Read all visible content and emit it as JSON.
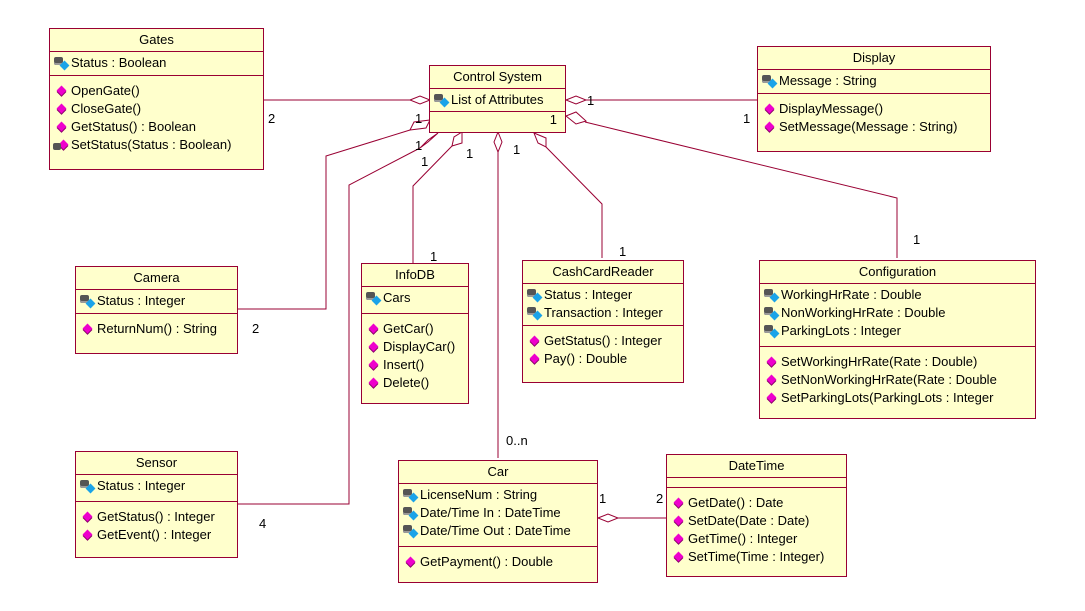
{
  "diagram": {
    "type": "UML class diagram",
    "colors": {
      "border": "#990033",
      "fill": "#ffffcc",
      "line": "#990033",
      "operation_icon": "#ee00cc",
      "attribute_icon": "#1aa3e8"
    },
    "classes": {
      "gates": {
        "name": "Gates",
        "attributes": [
          {
            "text": "Status : Boolean",
            "icon": "private-attribute-icon"
          }
        ],
        "operations": [
          {
            "text": "OpenGate()",
            "icon": "public-operation-icon"
          },
          {
            "text": "CloseGate()",
            "icon": "public-operation-icon"
          },
          {
            "text": "GetStatus() : Boolean",
            "icon": "public-operation-icon"
          },
          {
            "text": "SetStatus(Status : Boolean)",
            "icon": "private-operation-icon"
          }
        ]
      },
      "control_system": {
        "name": "Control System",
        "attributes": [
          {
            "text": "List of Attributes",
            "icon": "private-attribute-icon"
          }
        ],
        "operations_note": "1"
      },
      "display": {
        "name": "Display",
        "attributes": [
          {
            "text": "Message : String",
            "icon": "private-attribute-icon"
          }
        ],
        "operations": [
          {
            "text": "DisplayMessage()",
            "icon": "public-operation-icon"
          },
          {
            "text": "SetMessage(Message : String)",
            "icon": "public-operation-icon"
          }
        ]
      },
      "camera": {
        "name": "Camera",
        "attributes": [
          {
            "text": "Status : Integer",
            "icon": "private-attribute-icon"
          }
        ],
        "operations": [
          {
            "text": "ReturnNum() : String",
            "icon": "public-operation-icon"
          }
        ]
      },
      "infodb": {
        "name": "InfoDB",
        "attributes": [
          {
            "text": "Cars",
            "icon": "private-attribute-icon"
          }
        ],
        "operations": [
          {
            "text": "GetCar()",
            "icon": "public-operation-icon"
          },
          {
            "text": "DisplayCar()",
            "icon": "public-operation-icon"
          },
          {
            "text": "Insert()",
            "icon": "public-operation-icon"
          },
          {
            "text": "Delete()",
            "icon": "public-operation-icon"
          }
        ]
      },
      "cashcardreader": {
        "name": "CashCardReader",
        "attributes": [
          {
            "text": "Status : Integer",
            "icon": "private-attribute-icon"
          },
          {
            "text": "Transaction : Integer",
            "icon": "private-attribute-icon"
          }
        ],
        "operations": [
          {
            "text": "GetStatus() : Integer",
            "icon": "public-operation-icon"
          },
          {
            "text": "Pay() : Double",
            "icon": "public-operation-icon"
          }
        ]
      },
      "configuration": {
        "name": "Configuration",
        "attributes": [
          {
            "text": "WorkingHrRate : Double",
            "icon": "private-attribute-icon"
          },
          {
            "text": "NonWorkingHrRate : Double",
            "icon": "private-attribute-icon"
          },
          {
            "text": "ParkingLots : Integer",
            "icon": "private-attribute-icon"
          }
        ],
        "operations": [
          {
            "text": "SetWorkingHrRate(Rate : Double)",
            "icon": "public-operation-icon"
          },
          {
            "text": "SetNonWorkingHrRate(Rate : Double",
            "icon": "public-operation-icon"
          },
          {
            "text": "SetParkingLots(ParkingLots : Integer",
            "icon": "public-operation-icon"
          }
        ]
      },
      "sensor": {
        "name": "Sensor",
        "attributes": [
          {
            "text": "Status : Integer",
            "icon": "private-attribute-icon"
          }
        ],
        "operations": [
          {
            "text": "GetStatus() : Integer",
            "icon": "public-operation-icon"
          },
          {
            "text": "GetEvent() : Integer",
            "icon": "public-operation-icon"
          }
        ]
      },
      "car": {
        "name": "Car",
        "attributes": [
          {
            "text": "LicenseNum : String",
            "icon": "private-attribute-icon"
          },
          {
            "text": "Date/Time In : DateTime",
            "icon": "private-attribute-icon"
          },
          {
            "text": "Date/Time Out : DateTime",
            "icon": "private-attribute-icon"
          }
        ],
        "operations": [
          {
            "text": "GetPayment() : Double",
            "icon": "public-operation-icon"
          }
        ]
      },
      "datetime": {
        "name": "DateTime",
        "attributes": [],
        "operations": [
          {
            "text": "GetDate() : Date",
            "icon": "public-operation-icon"
          },
          {
            "text": "SetDate(Date : Date)",
            "icon": "public-operation-icon"
          },
          {
            "text": "GetTime() : Integer",
            "icon": "public-operation-icon"
          },
          {
            "text": "SetTime(Time : Integer)",
            "icon": "public-operation-icon"
          }
        ]
      }
    },
    "associations": [
      {
        "whole": "Control System",
        "part": "Gates",
        "whole_mult": "1",
        "part_mult": "2",
        "kind": "aggregation"
      },
      {
        "whole": "Control System",
        "part": "Display",
        "whole_mult": "1",
        "part_mult": "1",
        "kind": "aggregation"
      },
      {
        "whole": "Control System",
        "part": "Camera",
        "whole_mult": "1",
        "part_mult": "2",
        "kind": "aggregation"
      },
      {
        "whole": "Control System",
        "part": "Sensor",
        "whole_mult": "1",
        "part_mult": "4",
        "kind": "aggregation"
      },
      {
        "whole": "Control System",
        "part": "InfoDB",
        "whole_mult": "1",
        "part_mult": "1",
        "kind": "aggregation"
      },
      {
        "whole": "Control System",
        "part": "Car",
        "whole_mult": "1",
        "part_mult": "0..n",
        "kind": "aggregation"
      },
      {
        "whole": "Control System",
        "part": "CashCardReader",
        "whole_mult": "1",
        "part_mult": "1",
        "kind": "aggregation"
      },
      {
        "whole": "Control System",
        "part": "Configuration",
        "whole_mult": "1",
        "part_mult": "1",
        "kind": "aggregation"
      },
      {
        "whole": "Car",
        "part": "DateTime",
        "whole_mult": "1",
        "part_mult": "2",
        "kind": "aggregation"
      }
    ],
    "multiplicity_labels": {
      "gates_part": "2",
      "gates_whole": "1",
      "display_whole": "1",
      "display_part": "1",
      "camera_whole": "1",
      "camera_part": "2",
      "sensor_whole": "1",
      "sensor_part": "4",
      "infodb_whole": "1",
      "infodb_part": "1",
      "car_whole": "1",
      "car_part": "0..n",
      "ccr_whole": "1",
      "ccr_part": "1",
      "config_part": "1",
      "car_dt_whole": "1",
      "car_dt_part": "2"
    }
  }
}
